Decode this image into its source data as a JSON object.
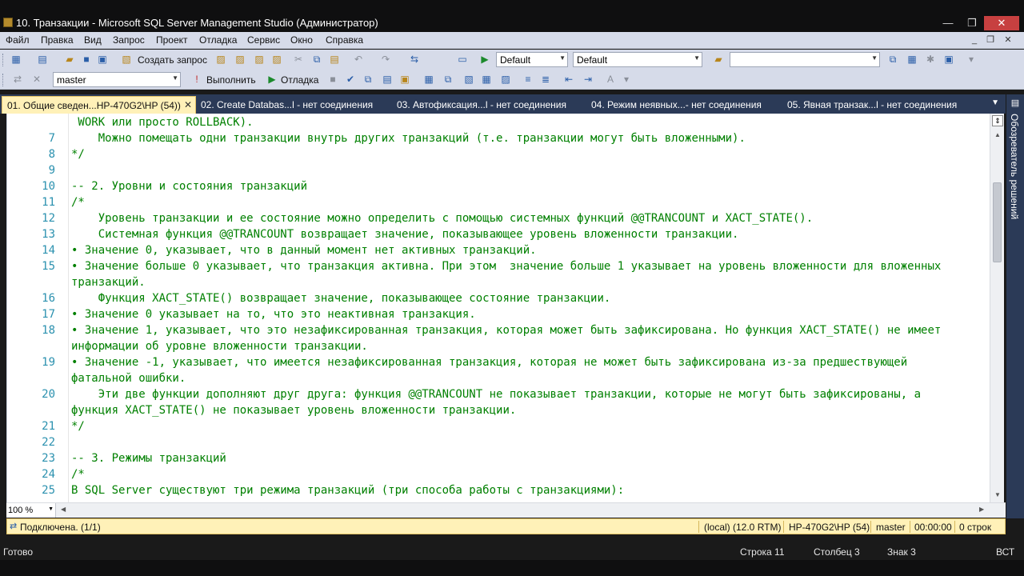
{
  "window": {
    "title": "10. Транзакции - Microsoft SQL Server Management Studio (Администратор)"
  },
  "menu": [
    "Файл",
    "Правка",
    "Вид",
    "Запрос",
    "Проект",
    "Отладка",
    "Сервис",
    "Окно",
    "Справка"
  ],
  "toolbar1": {
    "new_query_label": "Создать запрос",
    "combo1_value": "Default",
    "combo2_value": "Default",
    "combo3_value": ""
  },
  "toolbar2": {
    "database_value": "master",
    "execute_label": "Выполнить",
    "debug_label": "Отладка"
  },
  "tabs": [
    "01. Общие сведен...HP-470G2\\HP (54))",
    "02. Create Databas...l - нет соединения",
    "03. Автофиксация...l - нет соединения",
    "04. Режим неявных...- нет соединения",
    "05. Явная транзак...l - нет соединения"
  ],
  "side_panel": {
    "label": "Обозреватель решений"
  },
  "editor": {
    "lines": [
      {
        "n": "",
        "text": " WORK или просто ROLLBACK)."
      },
      {
        "n": "7",
        "text": "    Можно помещать одни транзакции внутрь других транзакций (т.е. транзакции могут быть вложенными)."
      },
      {
        "n": "8",
        "text": "*/"
      },
      {
        "n": "9",
        "text": ""
      },
      {
        "n": "10",
        "text": "-- 2. Уровни и состояния транзакций"
      },
      {
        "n": "11",
        "text": "/*"
      },
      {
        "n": "12",
        "text": "    Уровень транзакции и ее состояние можно определить с помощью системных функций @@TRANCOUNT и XACT_STATE()."
      },
      {
        "n": "13",
        "text": "    Системная функция @@TRANCOUNT возвращает значение, показывающее уровень вложенности транзакции."
      },
      {
        "n": "14",
        "text": "• Значение 0, указывает, что в данный момент нет активных транзакций."
      },
      {
        "n": "15",
        "text": "• Значение больше 0 указывает, что транзакция активна. При этом  значение больше 1 указывает на уровень вложенности для вложенных"
      },
      {
        "n": "",
        "text": "транзакций."
      },
      {
        "n": "16",
        "text": "    Функция XACT_STATE() возвращает значение, показывающее состояние транзакции."
      },
      {
        "n": "17",
        "text": "• Значение 0 указывает на то, что это неактивная транзакция."
      },
      {
        "n": "18",
        "text": "• Значение 1, указывает, что это незафиксированная транзакция, которая может быть зафиксирована. Но функция XACT_STATE() не имеет"
      },
      {
        "n": "",
        "text": "информации об уровне вложенности транзакции."
      },
      {
        "n": "19",
        "text": "• Значение -1, указывает, что имеется незафиксированная транзакция, которая не может быть зафиксирована из-за предшествующей"
      },
      {
        "n": "",
        "text": "фатальной ошибки."
      },
      {
        "n": "20",
        "text": "    Эти две функции дополняют друг друга: функция @@TRANCOUNT не показывает транзакции, которые не могут быть зафиксированы, а"
      },
      {
        "n": "",
        "text": "функция XACT_STATE() не показывает уровень вложенности транзакции."
      },
      {
        "n": "21",
        "text": "*/"
      },
      {
        "n": "22",
        "text": ""
      },
      {
        "n": "23",
        "text": "-- 3. Режимы транзакций"
      },
      {
        "n": "24",
        "text": "/*"
      },
      {
        "n": "25",
        "text": "В SQL Server существуют три режима транзакций (три способа работы с транзакциями):"
      }
    ]
  },
  "zoom": "100 %",
  "connection": {
    "status": "Подключена. (1/1)",
    "server": "(local) (12.0 RTM)",
    "user": "HP-470G2\\HP (54)",
    "database": "master",
    "time": "00:00:00",
    "rows": "0 строк"
  },
  "status": {
    "ready": "Готово",
    "row": "Строка 11",
    "column": "Столбец 3",
    "char": "Знак 3",
    "mode": "ВСТ"
  },
  "colors": {
    "comment": "#008000",
    "line_number": "#2b91af",
    "tab_bg": "#2b3a57",
    "active_tab": "#fff1b8"
  }
}
